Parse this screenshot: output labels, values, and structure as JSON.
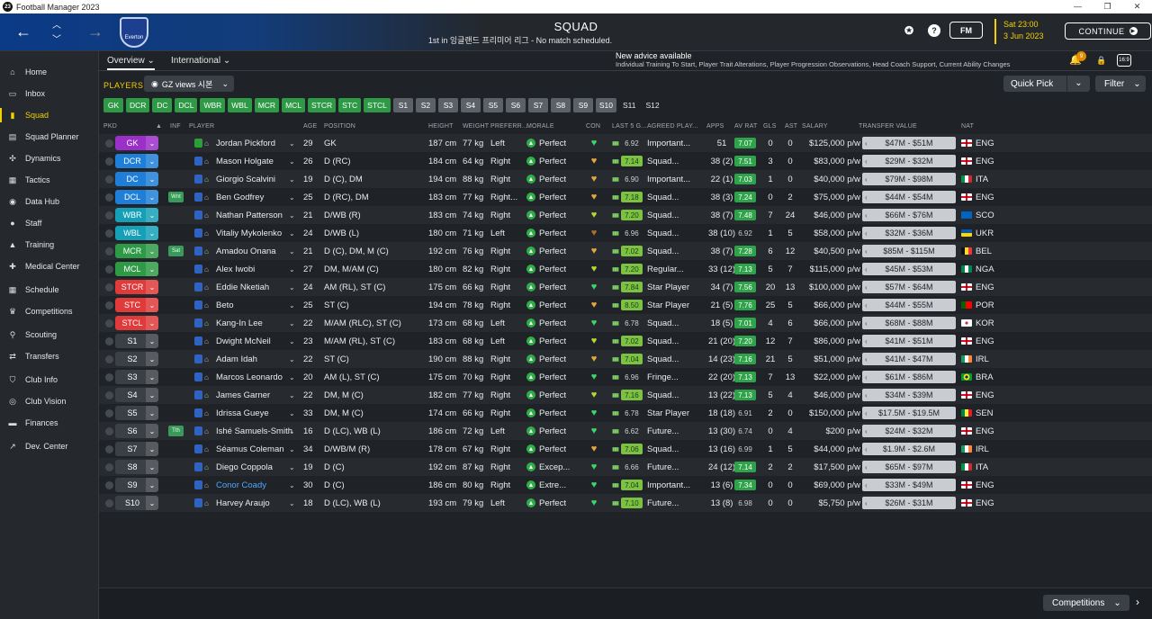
{
  "window": {
    "title": "Football Manager 2023",
    "app_icon": "23",
    "controls": [
      "—",
      "❐",
      "✕"
    ]
  },
  "topbar": {
    "club_name": "Everton",
    "title": "SQUAD",
    "subtitle": "1st in 잉글랜드 프리미어 리그 - No match scheduled.",
    "fm_button": "FM",
    "date_time": "Sat 23:00",
    "date": "3 Jun 2023",
    "continue_label": "CONTINUE",
    "help_icon": "?"
  },
  "sidebar": {
    "items": [
      {
        "label": "Home",
        "icon": "home-icon",
        "glyph": "⌂"
      },
      {
        "label": "Inbox",
        "icon": "inbox-icon",
        "glyph": "▭"
      },
      {
        "label": "Squad",
        "icon": "shirt-icon",
        "glyph": "▮",
        "active": true
      },
      {
        "label": "Squad Planner",
        "icon": "planner-icon",
        "glyph": "▤"
      },
      {
        "label": "Dynamics",
        "icon": "dynamics-icon",
        "glyph": "✣"
      },
      {
        "label": "Tactics",
        "icon": "tactics-icon",
        "glyph": "▦"
      },
      {
        "label": "Data Hub",
        "icon": "data-hub-icon",
        "glyph": "◉"
      },
      {
        "label": "Staff",
        "icon": "staff-icon",
        "glyph": "●"
      },
      {
        "label": "Training",
        "icon": "training-icon",
        "glyph": "▲"
      },
      {
        "label": "Medical Center",
        "icon": "medical-icon",
        "glyph": "✚"
      },
      {
        "label": "Schedule",
        "icon": "schedule-icon",
        "glyph": "▦"
      },
      {
        "label": "Competitions",
        "icon": "trophy-icon",
        "glyph": "♛"
      },
      {
        "label": "Scouting",
        "icon": "scouting-icon",
        "glyph": "⚲"
      },
      {
        "label": "Transfers",
        "icon": "transfers-icon",
        "glyph": "⇄"
      },
      {
        "label": "Club Info",
        "icon": "club-info-icon",
        "glyph": "⛉"
      },
      {
        "label": "Club Vision",
        "icon": "club-vision-icon",
        "glyph": "◎"
      },
      {
        "label": "Finances",
        "icon": "finances-icon",
        "glyph": "▬"
      },
      {
        "label": "Dev. Center",
        "icon": "dev-center-icon",
        "glyph": "↗"
      }
    ]
  },
  "subtabs": {
    "overview": "Overview",
    "international": "International"
  },
  "advice": {
    "title": "New advice available",
    "detail": "Individual Training To Start, Player Trait Alterations, Player Progression Observations, Head Coach Support, Current Ability Changes",
    "badge": "9"
  },
  "toolbar": {
    "players_label": "PLAYERS",
    "view_dropdown": "GZ views 시본",
    "quick_pick": "Quick Pick",
    "filter": "Filter",
    "screen_icon": "16:9"
  },
  "chips": [
    {
      "label": "GK",
      "on": true
    },
    {
      "label": "DCR",
      "on": true
    },
    {
      "label": "DC",
      "on": true
    },
    {
      "label": "DCL",
      "on": true
    },
    {
      "label": "WBR",
      "on": true
    },
    {
      "label": "WBL",
      "on": true
    },
    {
      "label": "MCR",
      "on": true
    },
    {
      "label": "MCL",
      "on": true
    },
    {
      "label": "STCR",
      "on": true
    },
    {
      "label": "STC",
      "on": true
    },
    {
      "label": "STCL",
      "on": true
    },
    {
      "label": "S1",
      "on": false
    },
    {
      "label": "S2",
      "on": false
    },
    {
      "label": "S3",
      "on": false
    },
    {
      "label": "S4",
      "on": false
    },
    {
      "label": "S5",
      "on": false
    },
    {
      "label": "S6",
      "on": false
    },
    {
      "label": "S7",
      "on": false
    },
    {
      "label": "S8",
      "on": false
    },
    {
      "label": "S9",
      "on": false
    },
    {
      "label": "S10",
      "on": false
    },
    {
      "label": "S11",
      "on": null
    },
    {
      "label": "S12",
      "on": null
    }
  ],
  "columns": {
    "pkd": "PKD",
    "inf": "INF",
    "player": "PLAYER",
    "age": "AGE",
    "position": "POSITION",
    "height": "HEIGHT",
    "weight": "WEIGHT",
    "foot": "PREFERR...",
    "morale": "MORALE",
    "con": "CON",
    "last5": "LAST 5 G...",
    "agreed": "AGREED PLAY...",
    "apps": "APPS",
    "avr": "AV RAT",
    "gls": "GLS",
    "ast": "AST",
    "salary": "SALARY",
    "tv": "TRANSFER VALUE",
    "nat": "NAT"
  },
  "colors": {
    "GK": "#9b30c9",
    "D": "#1f7fd8",
    "WB": "#16a0b8",
    "M": "#2e9a46",
    "ST": "#e03a3a",
    "S": "#3b4046",
    "heart_green": "#3fd66a",
    "heart_gold": "#e0a840",
    "heart_brown": "#a8702e",
    "heart_lime": "#b6d834"
  },
  "players": [
    {
      "pos": "GK",
      "pc": "GK",
      "inf": "",
      "name": "Jordan Pickford",
      "age": "29",
      "position": "GK",
      "height": "187 cm",
      "weight": "77 kg",
      "foot": "Left",
      "morale": "Perfect",
      "con": "heart_green",
      "l5": "6.92",
      "l5g": false,
      "agreed": "Important...",
      "apps": "51",
      "avr": "7.07",
      "avrg": true,
      "gls": "0",
      "ast": "0",
      "salary": "$125,000 p/w",
      "tv": "$47M - $51M",
      "nat": "ENG",
      "flag": "eng"
    },
    {
      "pos": "DCR",
      "pc": "D",
      "inf": "",
      "name": "Mason Holgate",
      "age": "26",
      "position": "D (RC)",
      "height": "184 cm",
      "weight": "64 kg",
      "foot": "Right",
      "morale": "Perfect",
      "con": "heart_gold",
      "l5": "7.14",
      "l5g": true,
      "agreed": "Squad...",
      "apps": "38 (2)",
      "avr": "7.51",
      "avrg": true,
      "gls": "3",
      "ast": "0",
      "salary": "$83,000 p/w",
      "tv": "$29M - $32M",
      "nat": "ENG",
      "flag": "eng"
    },
    {
      "pos": "DC",
      "pc": "D",
      "inf": "",
      "name": "Giorgio Scalvini",
      "age": "19",
      "position": "D (C), DM",
      "height": "194 cm",
      "weight": "88 kg",
      "foot": "Right",
      "morale": "Perfect",
      "con": "heart_gold",
      "l5": "6.90",
      "l5g": false,
      "agreed": "Important...",
      "apps": "22 (1)",
      "avr": "7.03",
      "avrg": true,
      "gls": "1",
      "ast": "0",
      "salary": "$40,000 p/w",
      "tv": "$79M - $98M",
      "nat": "ITA",
      "flag": "ita"
    },
    {
      "pos": "DCL",
      "pc": "D",
      "inf": "Wnt",
      "name": "Ben Godfrey",
      "age": "25",
      "position": "D (RC), DM",
      "height": "183 cm",
      "weight": "77 kg",
      "foot": "Right...",
      "morale": "Perfect",
      "con": "heart_gold",
      "l5": "7.18",
      "l5g": true,
      "agreed": "Squad...",
      "apps": "38 (3)",
      "avr": "7.24",
      "avrg": true,
      "gls": "0",
      "ast": "2",
      "salary": "$75,000 p/w",
      "tv": "$44M - $54M",
      "nat": "ENG",
      "flag": "eng"
    },
    {
      "pos": "WBR",
      "pc": "WB",
      "inf": "",
      "name": "Nathan Patterson",
      "age": "21",
      "position": "D/WB (R)",
      "height": "183 cm",
      "weight": "74 kg",
      "foot": "Right",
      "morale": "Perfect",
      "con": "heart_lime",
      "l5": "7.20",
      "l5g": true,
      "agreed": "Squad...",
      "apps": "38 (7)",
      "avr": "7.48",
      "avrg": true,
      "gls": "7",
      "ast": "24",
      "salary": "$46,000 p/w",
      "tv": "$66M - $76M",
      "nat": "SCO",
      "flag": "sco"
    },
    {
      "pos": "WBL",
      "pc": "WB",
      "inf": "",
      "name": "Vitaliy Mykolenko",
      "age": "24",
      "position": "D/WB (L)",
      "height": "180 cm",
      "weight": "71 kg",
      "foot": "Left",
      "morale": "Perfect",
      "con": "heart_brown",
      "l5": "6.96",
      "l5g": false,
      "agreed": "Squad...",
      "apps": "38 (10)",
      "avr": "6.92",
      "avrg": false,
      "gls": "1",
      "ast": "5",
      "salary": "$58,000 p/w",
      "tv": "$32M - $36M",
      "nat": "UKR",
      "flag": "ukr"
    },
    {
      "pos": "MCR",
      "pc": "M",
      "inf": "Sat",
      "name": "Amadou Onana",
      "age": "21",
      "position": "D (C), DM, M (C)",
      "height": "192 cm",
      "weight": "76 kg",
      "foot": "Right",
      "morale": "Perfect",
      "con": "heart_gold",
      "l5": "7.02",
      "l5g": true,
      "agreed": "Squad...",
      "apps": "38 (7)",
      "avr": "7.28",
      "avrg": true,
      "gls": "6",
      "ast": "12",
      "salary": "$40,500 p/w",
      "tv": "$85M - $115M",
      "nat": "BEL",
      "flag": "bel"
    },
    {
      "pos": "MCL",
      "pc": "M",
      "inf": "",
      "name": "Alex Iwobi",
      "age": "27",
      "position": "DM, M/AM (C)",
      "height": "180 cm",
      "weight": "82 kg",
      "foot": "Right",
      "morale": "Perfect",
      "con": "heart_lime",
      "l5": "7.20",
      "l5g": true,
      "agreed": "Regular...",
      "apps": "33 (12)",
      "avr": "7.13",
      "avrg": true,
      "gls": "5",
      "ast": "7",
      "salary": "$115,000 p/w",
      "tv": "$45M - $53M",
      "nat": "NGA",
      "flag": "nga"
    },
    {
      "pos": "STCR",
      "pc": "ST",
      "inf": "",
      "name": "Eddie Nketiah",
      "age": "24",
      "position": "AM (RL), ST (C)",
      "height": "175 cm",
      "weight": "66 kg",
      "foot": "Right",
      "morale": "Perfect",
      "con": "heart_green",
      "l5": "7.84",
      "l5g": true,
      "agreed": "Star Player",
      "apps": "34 (7)",
      "avr": "7.56",
      "avrg": true,
      "gls": "20",
      "ast": "13",
      "salary": "$100,000 p/w",
      "tv": "$57M - $64M",
      "nat": "ENG",
      "flag": "eng"
    },
    {
      "pos": "STC",
      "pc": "ST",
      "inf": "",
      "name": "Beto",
      "age": "25",
      "position": "ST (C)",
      "height": "194 cm",
      "weight": "78 kg",
      "foot": "Right",
      "morale": "Perfect",
      "con": "heart_gold",
      "l5": "8.50",
      "l5g": true,
      "agreed": "Star Player",
      "apps": "21 (5)",
      "avr": "7.76",
      "avrg": true,
      "gls": "25",
      "ast": "5",
      "salary": "$66,000 p/w",
      "tv": "$44M - $55M",
      "nat": "POR",
      "flag": "por"
    },
    {
      "pos": "STCL",
      "pc": "ST",
      "inf": "",
      "name": "Kang-In Lee",
      "age": "22",
      "position": "M/AM (RLC), ST (C)",
      "height": "173 cm",
      "weight": "68 kg",
      "foot": "Left",
      "morale": "Perfect",
      "con": "heart_green",
      "l5": "6.78",
      "l5g": false,
      "agreed": "Squad...",
      "apps": "18 (5)",
      "avr": "7.01",
      "avrg": true,
      "gls": "4",
      "ast": "6",
      "salary": "$66,000 p/w",
      "tv": "$68M - $88M",
      "nat": "KOR",
      "flag": "kor"
    },
    {
      "pos": "S1",
      "pc": "S",
      "inf": "",
      "name": "Dwight McNeil",
      "age": "23",
      "position": "M/AM (RL), ST (C)",
      "height": "183 cm",
      "weight": "68 kg",
      "foot": "Left",
      "morale": "Perfect",
      "con": "heart_lime",
      "l5": "7.02",
      "l5g": true,
      "agreed": "Squad...",
      "apps": "21 (20)",
      "avr": "7.20",
      "avrg": true,
      "gls": "12",
      "ast": "7",
      "salary": "$86,000 p/w",
      "tv": "$41M - $51M",
      "nat": "ENG",
      "flag": "eng"
    },
    {
      "pos": "S2",
      "pc": "S",
      "inf": "",
      "name": "Adam Idah",
      "age": "22",
      "position": "ST (C)",
      "height": "190 cm",
      "weight": "88 kg",
      "foot": "Right",
      "morale": "Perfect",
      "con": "heart_gold",
      "l5": "7.04",
      "l5g": true,
      "agreed": "Squad...",
      "apps": "14 (23)",
      "avr": "7.16",
      "avrg": true,
      "gls": "21",
      "ast": "5",
      "salary": "$51,000 p/w",
      "tv": "$41M - $47M",
      "nat": "IRL",
      "flag": "irl"
    },
    {
      "pos": "S3",
      "pc": "S",
      "inf": "",
      "name": "Marcos Leonardo",
      "age": "20",
      "position": "AM (L), ST (C)",
      "height": "175 cm",
      "weight": "70 kg",
      "foot": "Right",
      "morale": "Perfect",
      "con": "heart_green",
      "l5": "6.96",
      "l5g": false,
      "agreed": "Fringe...",
      "apps": "22 (20)",
      "avr": "7.13",
      "avrg": true,
      "gls": "7",
      "ast": "13",
      "salary": "$22,000 p/w",
      "tv": "$61M - $86M",
      "nat": "BRA",
      "flag": "bra"
    },
    {
      "pos": "S4",
      "pc": "S",
      "inf": "",
      "name": "James Garner",
      "age": "22",
      "position": "DM, M (C)",
      "height": "182 cm",
      "weight": "77 kg",
      "foot": "Right",
      "morale": "Perfect",
      "con": "heart_lime",
      "l5": "7.16",
      "l5g": true,
      "agreed": "Squad...",
      "apps": "13 (22)",
      "avr": "7.13",
      "avrg": true,
      "gls": "5",
      "ast": "4",
      "salary": "$46,000 p/w",
      "tv": "$34M - $39M",
      "nat": "ENG",
      "flag": "eng"
    },
    {
      "pos": "S5",
      "pc": "S",
      "inf": "",
      "name": "Idrissa Gueye",
      "age": "33",
      "position": "DM, M (C)",
      "height": "174 cm",
      "weight": "66 kg",
      "foot": "Right",
      "morale": "Perfect",
      "con": "heart_green",
      "l5": "6.78",
      "l5g": false,
      "agreed": "Star Player",
      "apps": "18 (18)",
      "avr": "6.91",
      "avrg": false,
      "gls": "2",
      "ast": "0",
      "salary": "$150,000 p/w",
      "tv": "$17.5M - $19.5M",
      "nat": "SEN",
      "flag": "sen"
    },
    {
      "pos": "S6",
      "pc": "S",
      "inf": "Tth",
      "name": "Ishé Samuels-Smith",
      "age": "16",
      "position": "D (LC), WB (L)",
      "height": "186 cm",
      "weight": "72 kg",
      "foot": "Left",
      "morale": "Perfect",
      "con": "heart_green",
      "l5": "6.62",
      "l5g": false,
      "agreed": "Future...",
      "apps": "13 (30)",
      "avr": "6.74",
      "avrg": false,
      "gls": "0",
      "ast": "4",
      "salary": "$200 p/w",
      "tv": "$24M - $32M",
      "nat": "ENG",
      "flag": "eng"
    },
    {
      "pos": "S7",
      "pc": "S",
      "inf": "",
      "name": "Séamus Coleman",
      "age": "34",
      "position": "D/WB/M (R)",
      "height": "178 cm",
      "weight": "67 kg",
      "foot": "Right",
      "morale": "Perfect",
      "con": "heart_gold",
      "l5": "7.06",
      "l5g": true,
      "agreed": "Squad...",
      "apps": "13 (16)",
      "avr": "6.99",
      "avrg": false,
      "gls": "1",
      "ast": "5",
      "salary": "$44,000 p/w",
      "tv": "$1.9M - $2.6M",
      "nat": "IRL",
      "flag": "irl"
    },
    {
      "pos": "S8",
      "pc": "S",
      "inf": "",
      "name": "Diego Coppola",
      "age": "19",
      "position": "D (C)",
      "height": "192 cm",
      "weight": "87 kg",
      "foot": "Right",
      "morale": "Excep...",
      "con": "heart_green",
      "l5": "6.66",
      "l5g": false,
      "agreed": "Future...",
      "apps": "24 (12)",
      "avr": "7.14",
      "avrg": true,
      "gls": "2",
      "ast": "2",
      "salary": "$17,500 p/w",
      "tv": "$65M - $97M",
      "nat": "ITA",
      "flag": "ita"
    },
    {
      "pos": "S9",
      "pc": "S",
      "inf": "",
      "name": "Conor Coady",
      "loan": true,
      "age": "30",
      "position": "D (C)",
      "height": "186 cm",
      "weight": "80 kg",
      "foot": "Right",
      "morale": "Extre...",
      "con": "heart_green",
      "l5": "7.04",
      "l5g": true,
      "agreed": "Important...",
      "apps": "13 (6)",
      "avr": "7.34",
      "avrg": true,
      "gls": "0",
      "ast": "0",
      "salary": "$69,000 p/w",
      "tv": "$33M - $49M",
      "nat": "ENG",
      "flag": "eng"
    },
    {
      "pos": "S10",
      "pc": "S",
      "inf": "",
      "name": "Harvey Araujo",
      "age": "18",
      "position": "D (LC), WB (L)",
      "height": "193 cm",
      "weight": "79 kg",
      "foot": "Left",
      "morale": "Perfect",
      "con": "heart_green",
      "l5": "7.10",
      "l5g": true,
      "agreed": "Future...",
      "apps": "13 (8)",
      "avr": "6.98",
      "avrg": false,
      "gls": "0",
      "ast": "0",
      "salary": "$5,750 p/w",
      "tv": "$26M - $31M",
      "nat": "ENG",
      "flag": "eng"
    }
  ],
  "bottom": {
    "competitions": "Competitions"
  }
}
